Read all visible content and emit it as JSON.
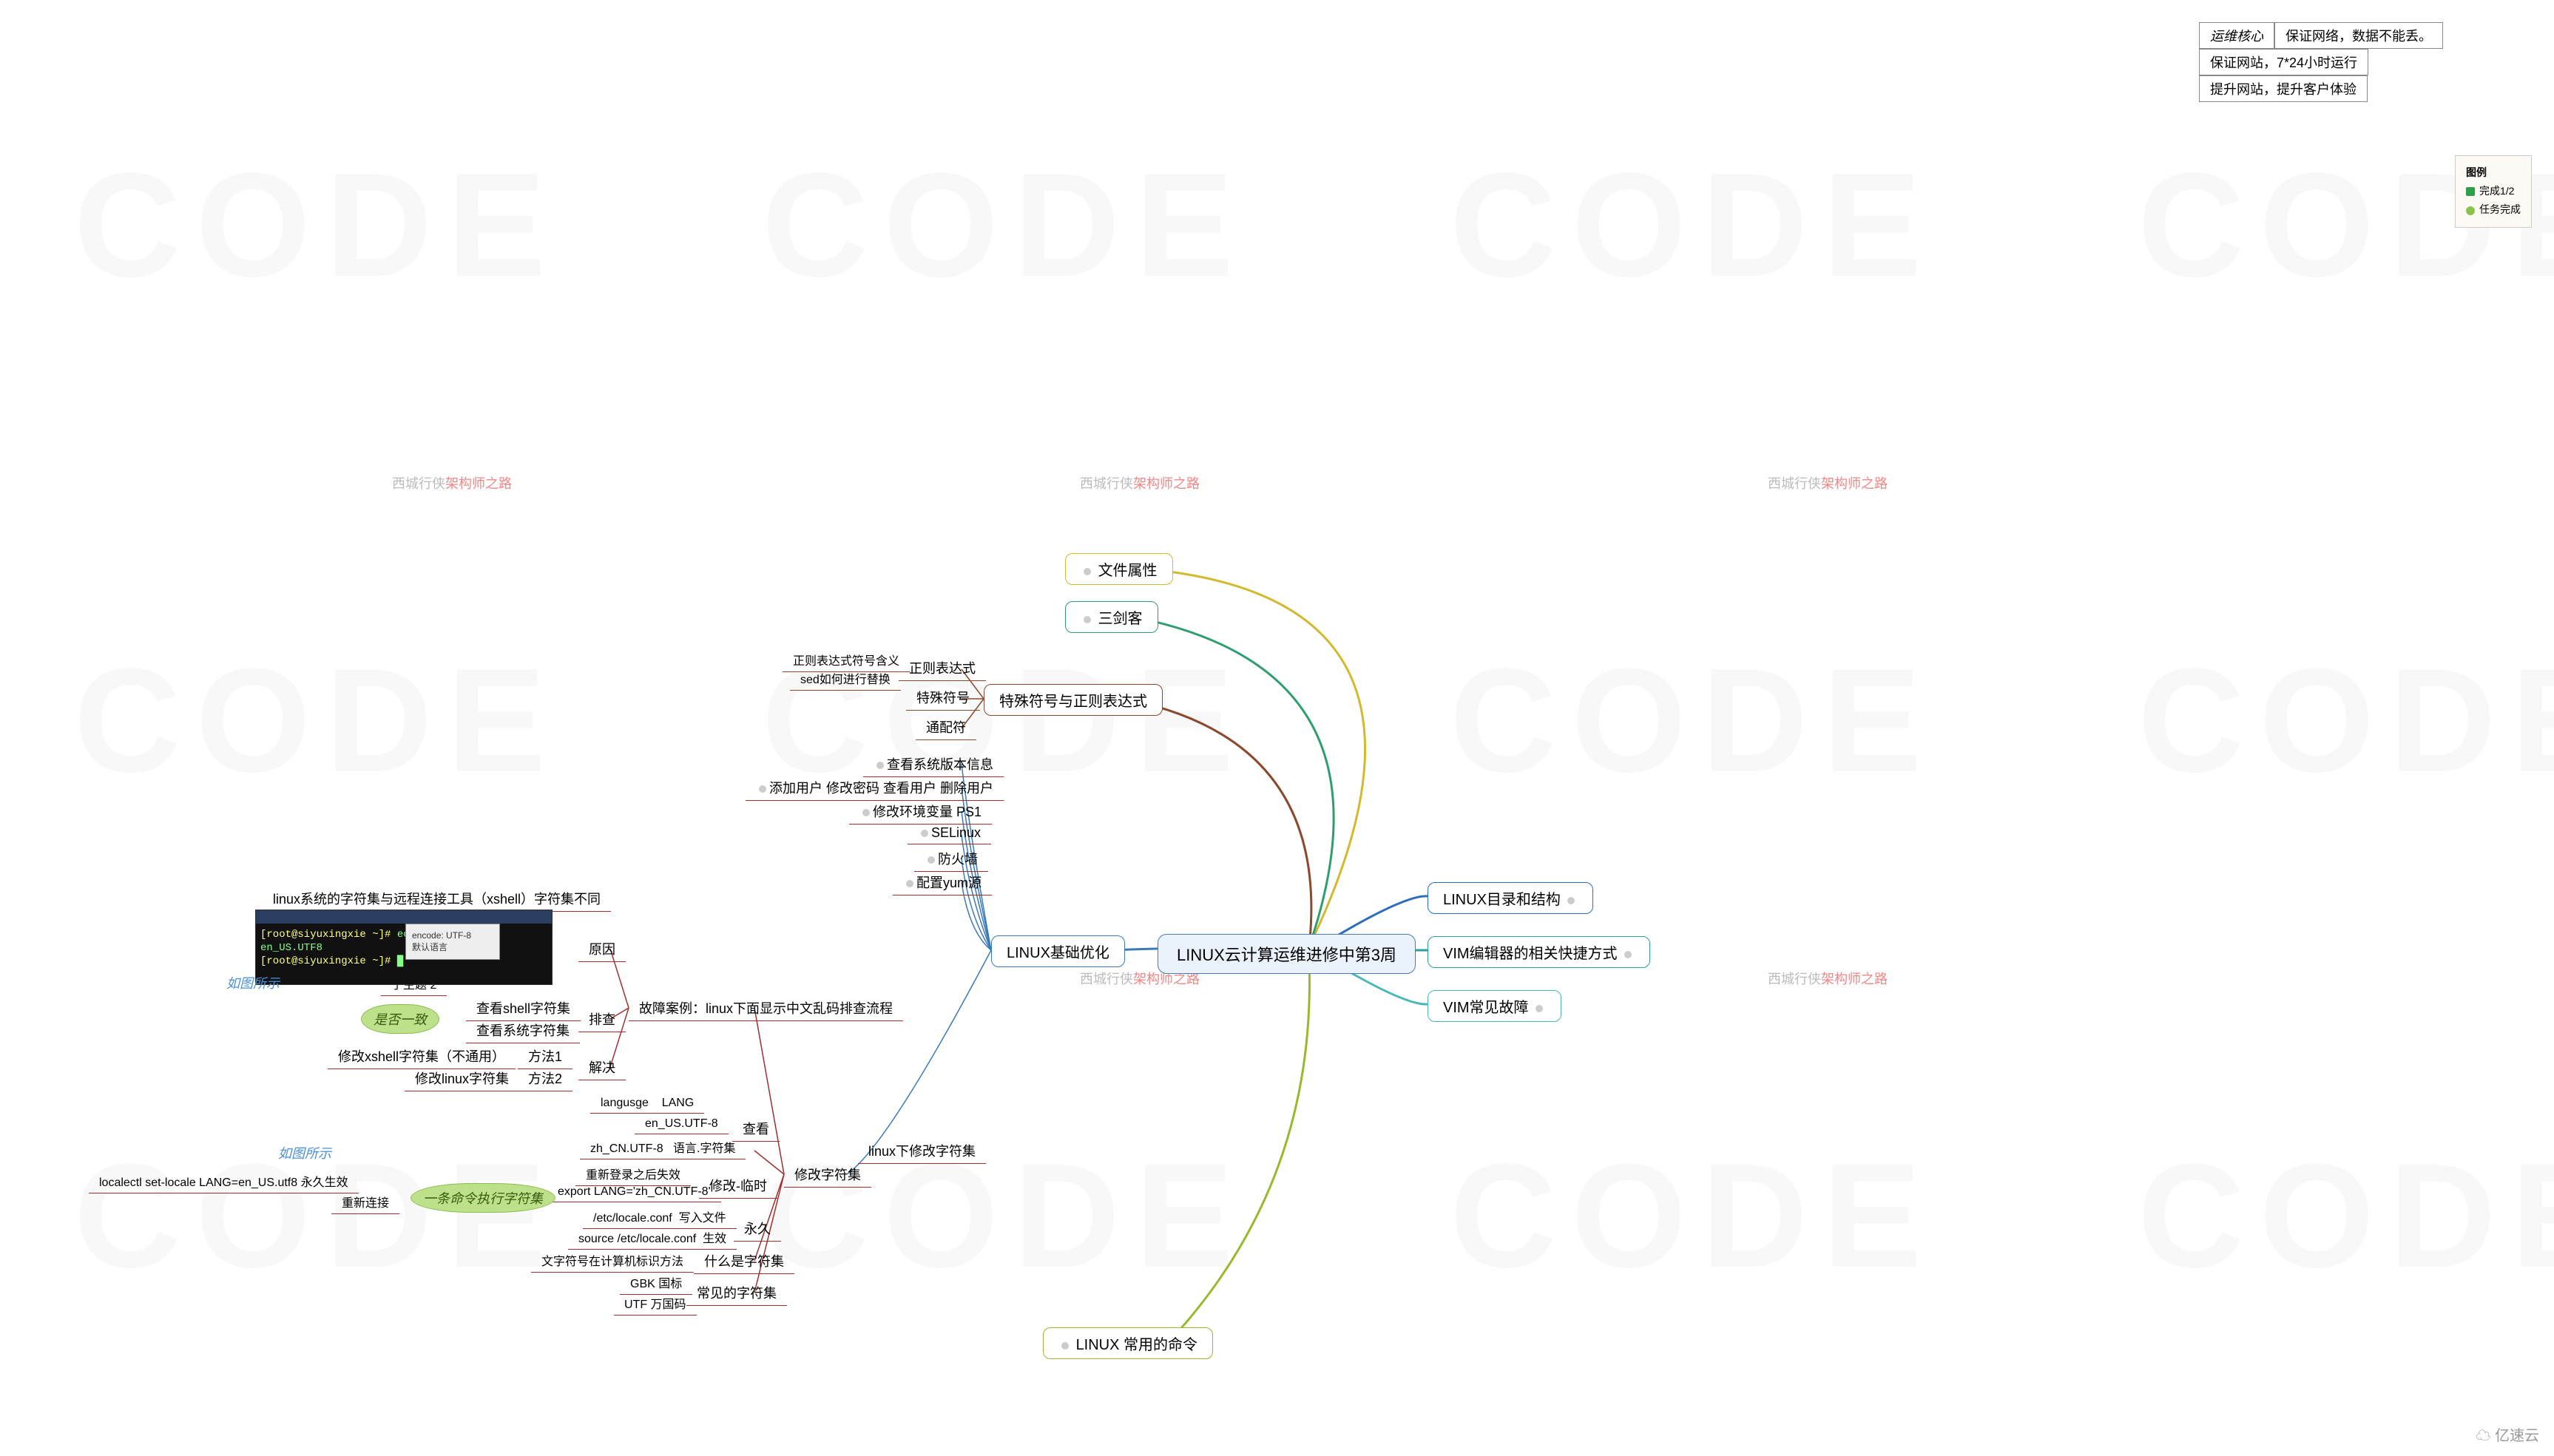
{
  "center": "LINUX云计算运维进修中第3周",
  "ops_core": {
    "label": "运维核心",
    "lines": [
      "保证网络，数据不能丢。",
      "保证网站，7*24小时运行",
      "提升网站，提升客户体验"
    ]
  },
  "legend": {
    "title": "图例",
    "rows": [
      {
        "color": "#2e9e4a",
        "label": "完成1/2"
      },
      {
        "color": "#8bc34a",
        "label": "任务完成"
      }
    ]
  },
  "right_nodes": {
    "dir": "LINUX目录和结构",
    "vim_shortcut": "VIM编辑器的相关快捷方式",
    "vim_fault": "VIM常见故障"
  },
  "top_nodes": {
    "file_attr": "文件属性",
    "sanjianke": "三剑客",
    "regex_main": "特殊符号与正则表达式",
    "regex_children": [
      "正则表达式",
      "特殊符号",
      "通配符"
    ],
    "regex_notes": [
      "正则表达式符号含义",
      "sed如何进行替换"
    ]
  },
  "left_main": {
    "opt": "LINUX基础优化",
    "opt_children": [
      "查看系统版本信息",
      "添加用户 修改密码 查看用户 删除用户",
      "修改环境变量 PS1",
      "SELinux",
      "防火墙",
      "配置yum源"
    ],
    "charset": "修改字符集",
    "charset_sub": "linux下修改字符集",
    "case": "故障案例：linux下面显示中文乱码排查流程",
    "case_children": {
      "reason": "原因",
      "reason_sub": "linux系统的字符集与远程连接工具（xshell）字符集不同",
      "check": "排查",
      "check_children": [
        "查看shell字符集",
        "查看系统字符集"
      ],
      "solve": "解决",
      "solve_children": [
        {
          "m": "方法1",
          "d": "修改xshell字符集（不通用）"
        },
        {
          "m": "方法2",
          "d": "修改linux字符集"
        }
      ]
    },
    "charset_what": "什么是字符集",
    "charset_what_sub": "文字符号在计算机标识方法",
    "common": "常见的字符集",
    "common_children": [
      "GBK 国标",
      "UTF 万国码"
    ],
    "view": "查看",
    "view_children": [
      {
        "k": "langusge",
        "v": "LANG"
      },
      {
        "k": "en_US.UTF-8",
        "v": ""
      },
      {
        "k": "zh_CN.UTF-8",
        "v": "语言.字符集"
      }
    ],
    "modify": "修改-临时",
    "modify_children": [
      "重新登录之后失效",
      "export LANG='zh_CN.UTF-8'"
    ],
    "perm": "永久",
    "perm_children": [
      {
        "k": "/etc/locale.conf",
        "v": "写入文件"
      },
      {
        "k": "source /etc/locale.conf",
        "v": "生效"
      }
    ],
    "cmd_line": "一条命令执行字符集",
    "cmd_children": [
      {
        "k": "localectl set-locale LANG=en_US.utf8",
        "v": "永久生效"
      },
      {
        "k": "",
        "v": "重新连接"
      }
    ]
  },
  "bottom": "LINUX 常用的命令",
  "callouts": {
    "isone": "是否一致",
    "asimg": "如图所示",
    "sub2": "子主题 2"
  },
  "watermark": "西城行侠",
  "watermark_suffix": "架构师之路",
  "brand": "亿速云"
}
